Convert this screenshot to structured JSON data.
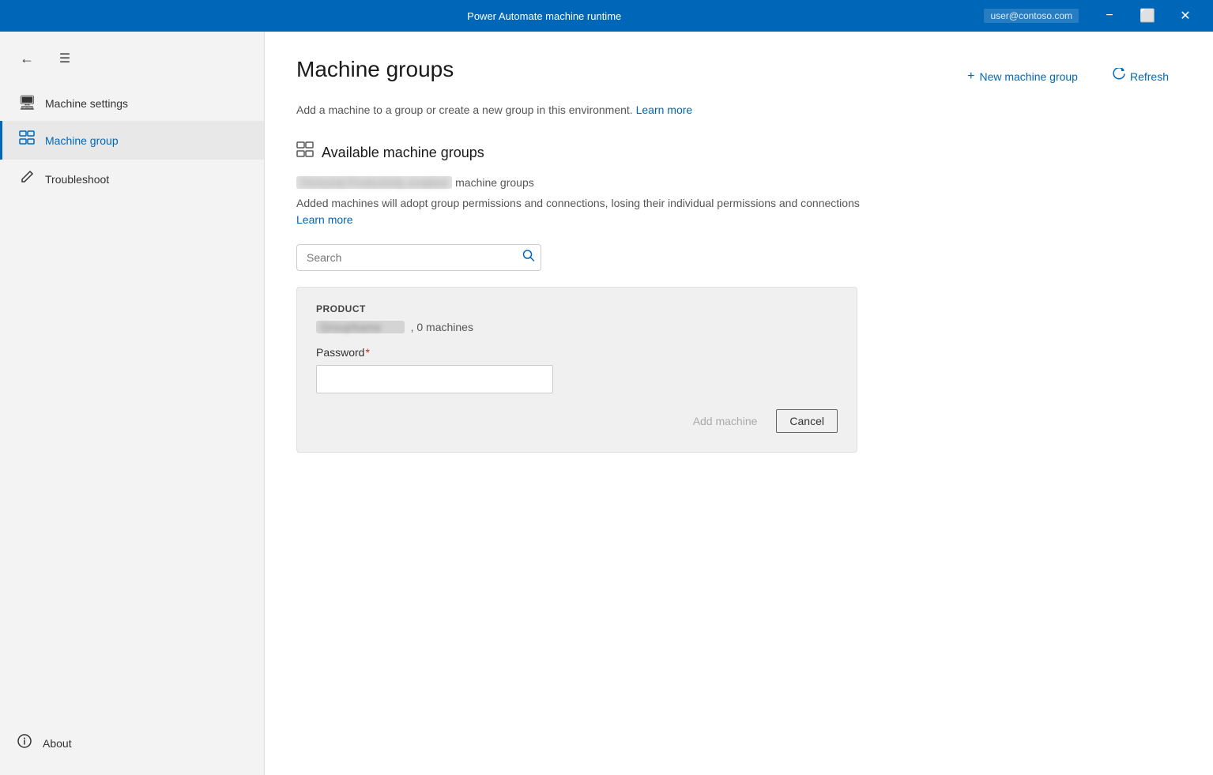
{
  "titlebar": {
    "title": "Power Automate machine runtime",
    "user": "user@contoso.com",
    "minimize_label": "−",
    "restore_label": "⬜",
    "close_label": "✕"
  },
  "sidebar": {
    "back_label": "←",
    "menu_label": "☰",
    "nav_items": [
      {
        "id": "machine-settings",
        "label": "Machine settings",
        "icon": "🖥",
        "active": false
      },
      {
        "id": "machine-group",
        "label": "Machine group",
        "icon": "⊞",
        "active": true
      },
      {
        "id": "troubleshoot",
        "label": "Troubleshoot",
        "icon": "🔧",
        "active": false
      }
    ],
    "footer": {
      "about_label": "About",
      "about_icon": "ℹ"
    }
  },
  "main": {
    "page_title": "Machine groups",
    "subtitle_text": "Add a machine to a group or create a new group in this environment.",
    "subtitle_link": "Learn more",
    "actions": {
      "new_machine_group_label": "New machine group",
      "refresh_label": "Refresh"
    },
    "section": {
      "title": "Available machine groups",
      "icon": "⊞"
    },
    "env_display": "Personal Productivity enabled",
    "env_suffix": "machine groups",
    "description_text": "Added machines will adopt group permissions and connections, losing their individual permissions and connections",
    "description_link": "Learn more",
    "search": {
      "placeholder": "Search",
      "icon": "🔍"
    },
    "card": {
      "product_label": "PRODUCT",
      "group_name_display": "GroupName",
      "machines_count": ", 0 machines",
      "password_label": "Password",
      "password_required": "*",
      "password_placeholder": "",
      "add_machine_label": "Add machine",
      "cancel_label": "Cancel"
    }
  }
}
